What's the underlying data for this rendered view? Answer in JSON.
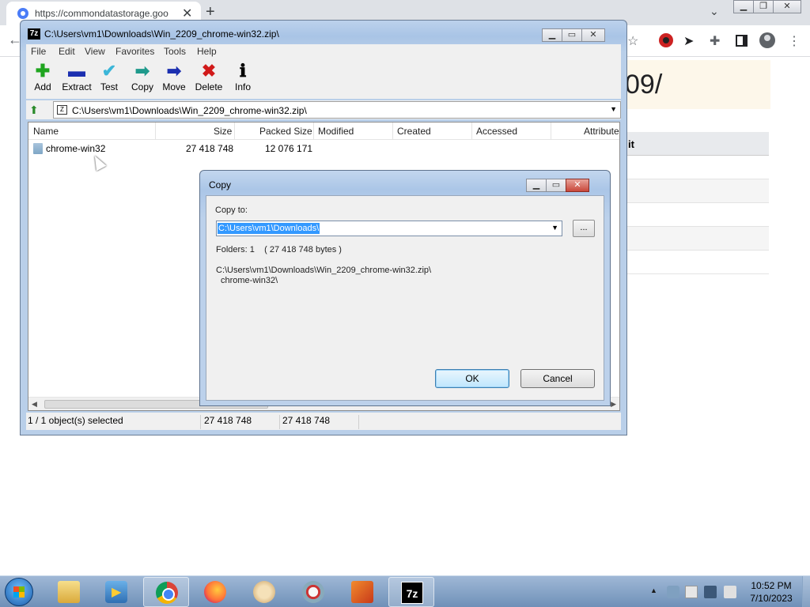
{
  "browser": {
    "tab_title": "https://commondatastorage.goo",
    "page_heading_fragment": "09/",
    "table_header_fragment": "it"
  },
  "zip_window": {
    "title": "C:\\Users\\vm1\\Downloads\\Win_2209_chrome-win32.zip\\",
    "icon_text": "7z",
    "menu": [
      "File",
      "Edit",
      "View",
      "Favorites",
      "Tools",
      "Help"
    ],
    "toolbar": [
      {
        "label": "Add",
        "icon": "plus-icon",
        "color": "#1fa51f"
      },
      {
        "label": "Extract",
        "icon": "minus-icon",
        "color": "#1b2fb0"
      },
      {
        "label": "Test",
        "icon": "check-icon",
        "color": "#3bb6d8"
      },
      {
        "label": "Copy",
        "icon": "copy-arrow-icon",
        "color": "#1f9a8c"
      },
      {
        "label": "Move",
        "icon": "move-arrow-icon",
        "color": "#1b2fb0"
      },
      {
        "label": "Delete",
        "icon": "delete-x-icon",
        "color": "#d11a1a"
      },
      {
        "label": "Info",
        "icon": "info-icon",
        "color": "#000000"
      }
    ],
    "address_path": "C:\\Users\\vm1\\Downloads\\Win_2209_chrome-win32.zip\\",
    "columns": [
      "Name",
      "Size",
      "Packed Size",
      "Modified",
      "Created",
      "Accessed",
      "Attribute"
    ],
    "rows": [
      {
        "name": "chrome-win32",
        "size": "27 418 748",
        "packed_size": "12 076 171",
        "modified": "",
        "created": "",
        "accessed": "",
        "attributes": ""
      }
    ],
    "status": {
      "selected": "1 / 1 object(s) selected",
      "size": "27 418 748",
      "packed": "27 418 748"
    }
  },
  "copy_dialog": {
    "title": "Copy",
    "copy_to_label": "Copy to:",
    "destination": "C:\\Users\\vm1\\Downloads\\",
    "browse_label": "...",
    "folders_info": "Folders: 1    ( 27 418 748 bytes )",
    "source_path": "C:\\Users\\vm1\\Downloads\\Win_2209_chrome-win32.zip\\",
    "source_item": "chrome-win32\\",
    "ok_label": "OK",
    "cancel_label": "Cancel"
  },
  "taskbar": {
    "items": [
      "file-explorer",
      "media-player",
      "chrome",
      "firefox",
      "paint",
      "snipping-tool",
      "pen-app",
      "7zip"
    ],
    "active": "7zip",
    "time": "10:52 PM",
    "date": "7/10/2023"
  }
}
